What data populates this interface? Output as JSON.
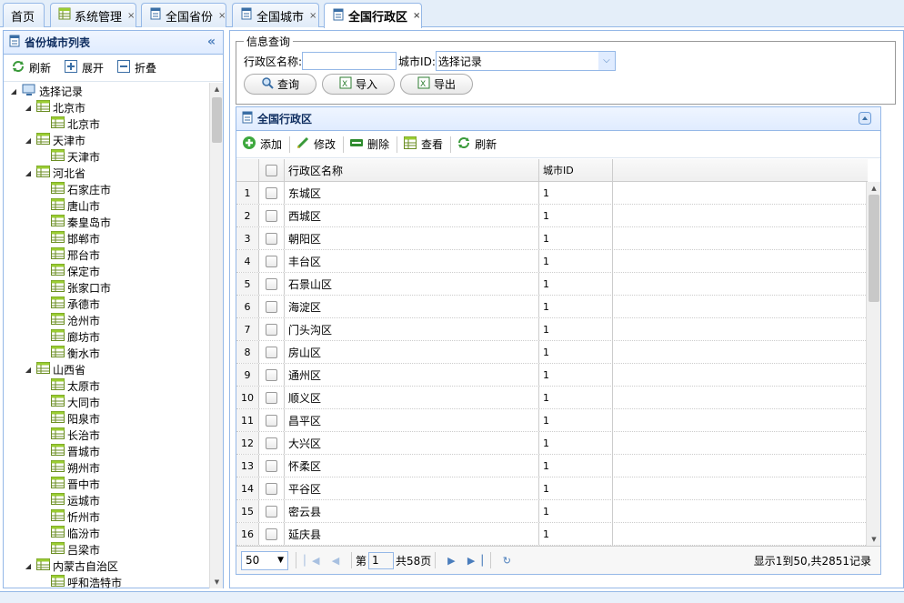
{
  "tabs": [
    {
      "label": "首页",
      "icon": null,
      "closable": false,
      "active": false
    },
    {
      "label": "系统管理",
      "icon": "table-icon",
      "closable": true,
      "active": false
    },
    {
      "label": "全国省份",
      "icon": "form-icon",
      "closable": true,
      "active": false
    },
    {
      "label": "全国城市",
      "icon": "form-icon",
      "closable": true,
      "active": false
    },
    {
      "label": "全国行政区",
      "icon": "form-icon",
      "closable": true,
      "active": true
    }
  ],
  "tab_close_glyph": "×",
  "left_panel": {
    "title": "省份城市列表",
    "collapse_glyph": "«",
    "toolbar": {
      "refresh": "刷新",
      "expand": "展开",
      "collapse": "折叠"
    },
    "tree": [
      {
        "label": "选择记录",
        "level": 0,
        "expanded": true,
        "icon": "root"
      },
      {
        "label": "北京市",
        "level": 1,
        "expanded": true
      },
      {
        "label": "北京市",
        "level": 2
      },
      {
        "label": "天津市",
        "level": 1,
        "expanded": true
      },
      {
        "label": "天津市",
        "level": 2
      },
      {
        "label": "河北省",
        "level": 1,
        "expanded": true
      },
      {
        "label": "石家庄市",
        "level": 2
      },
      {
        "label": "唐山市",
        "level": 2
      },
      {
        "label": "秦皇岛市",
        "level": 2
      },
      {
        "label": "邯郸市",
        "level": 2
      },
      {
        "label": "邢台市",
        "level": 2
      },
      {
        "label": "保定市",
        "level": 2
      },
      {
        "label": "张家口市",
        "level": 2
      },
      {
        "label": "承德市",
        "level": 2
      },
      {
        "label": "沧州市",
        "level": 2
      },
      {
        "label": "廊坊市",
        "level": 2
      },
      {
        "label": "衡水市",
        "level": 2
      },
      {
        "label": "山西省",
        "level": 1,
        "expanded": true
      },
      {
        "label": "太原市",
        "level": 2
      },
      {
        "label": "大同市",
        "level": 2
      },
      {
        "label": "阳泉市",
        "level": 2
      },
      {
        "label": "长治市",
        "level": 2
      },
      {
        "label": "晋城市",
        "level": 2
      },
      {
        "label": "朔州市",
        "level": 2
      },
      {
        "label": "晋中市",
        "level": 2
      },
      {
        "label": "运城市",
        "level": 2
      },
      {
        "label": "忻州市",
        "level": 2
      },
      {
        "label": "临汾市",
        "level": 2
      },
      {
        "label": "吕梁市",
        "level": 2
      },
      {
        "label": "内蒙古自治区",
        "level": 1,
        "expanded": true
      },
      {
        "label": "呼和浩特市",
        "level": 2
      }
    ]
  },
  "query": {
    "legend": "信息查询",
    "name_label": "行政区名称:",
    "name_value": "",
    "city_label": "城市ID:",
    "city_value": "选择记录",
    "search": "查询",
    "import": "导入",
    "export": "导出"
  },
  "grid": {
    "title": "全国行政区",
    "toolbar": {
      "add": "添加",
      "edit": "修改",
      "delete": "删除",
      "view": "查看",
      "refresh": "刷新"
    },
    "columns": {
      "name": "行政区名称",
      "city": "城市ID"
    },
    "rows": [
      {
        "n": "1",
        "name": "东城区",
        "city": "1"
      },
      {
        "n": "2",
        "name": "西城区",
        "city": "1"
      },
      {
        "n": "3",
        "name": "朝阳区",
        "city": "1"
      },
      {
        "n": "4",
        "name": "丰台区",
        "city": "1"
      },
      {
        "n": "5",
        "name": "石景山区",
        "city": "1"
      },
      {
        "n": "6",
        "name": "海淀区",
        "city": "1"
      },
      {
        "n": "7",
        "name": "门头沟区",
        "city": "1"
      },
      {
        "n": "8",
        "name": "房山区",
        "city": "1"
      },
      {
        "n": "9",
        "name": "通州区",
        "city": "1"
      },
      {
        "n": "10",
        "name": "顺义区",
        "city": "1"
      },
      {
        "n": "11",
        "name": "昌平区",
        "city": "1"
      },
      {
        "n": "12",
        "name": "大兴区",
        "city": "1"
      },
      {
        "n": "13",
        "name": "怀柔区",
        "city": "1"
      },
      {
        "n": "14",
        "name": "平谷区",
        "city": "1"
      },
      {
        "n": "15",
        "name": "密云县",
        "city": "1"
      },
      {
        "n": "16",
        "name": "延庆县",
        "city": "1"
      }
    ],
    "pager": {
      "page_size": "50",
      "page_prefix": "第",
      "page_value": "1",
      "page_suffix": "共58页",
      "info": "显示1到50,共2851记录"
    }
  }
}
